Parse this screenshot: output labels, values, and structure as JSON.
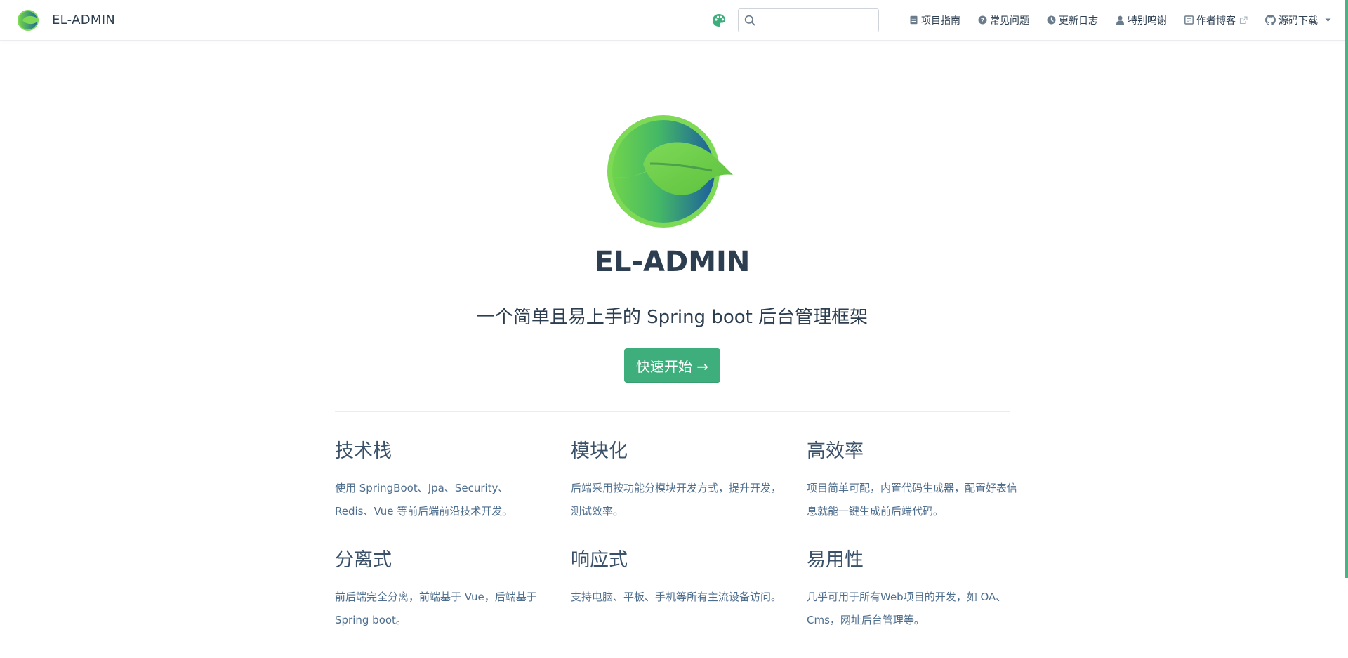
{
  "header": {
    "title": "EL-ADMIN",
    "search": {
      "value": "",
      "placeholder": ""
    },
    "nav_items": [
      {
        "label": "项目指南",
        "icon": "book-icon"
      },
      {
        "label": "常见问题",
        "icon": "question-circle-icon"
      },
      {
        "label": "更新日志",
        "icon": "clock-icon"
      },
      {
        "label": "特别鸣谢",
        "icon": "user-icon"
      },
      {
        "label": "作者博客",
        "icon": "newspaper-icon",
        "external": true
      },
      {
        "label": "源码下载",
        "icon": "github-icon",
        "dropdown": true
      }
    ]
  },
  "hero": {
    "title": "EL-ADMIN",
    "description": "一个简单且易上手的 Spring boot 后台管理框架",
    "action": "快速开始 →"
  },
  "features": [
    {
      "title": "技术栈",
      "details": "使用 SpringBoot、Jpa、Security、Redis、Vue 等前后端前沿技术开发。"
    },
    {
      "title": "模块化",
      "details": "后端采用按功能分模块开发方式，提升开发，测试效率。"
    },
    {
      "title": "高效率",
      "details": "项目简单可配，内置代码生成器，配置好表信息就能一键生成前后端代码。"
    },
    {
      "title": "分离式",
      "details": "前后端完全分离，前端基于 Vue，后端基于 Spring boot。"
    },
    {
      "title": "响应式",
      "details": "支持电脑、平板、手机等所有主流设备访问。"
    },
    {
      "title": "易用性",
      "details": "几乎可用于所有Web项目的开发，如 OA、Cms，网址后台管理等。"
    }
  ],
  "colors": {
    "accent": "#3eaf7c",
    "text": "#2c3e50",
    "logo_green": "#7ed957",
    "logo_blue": "#1e5f9c"
  }
}
